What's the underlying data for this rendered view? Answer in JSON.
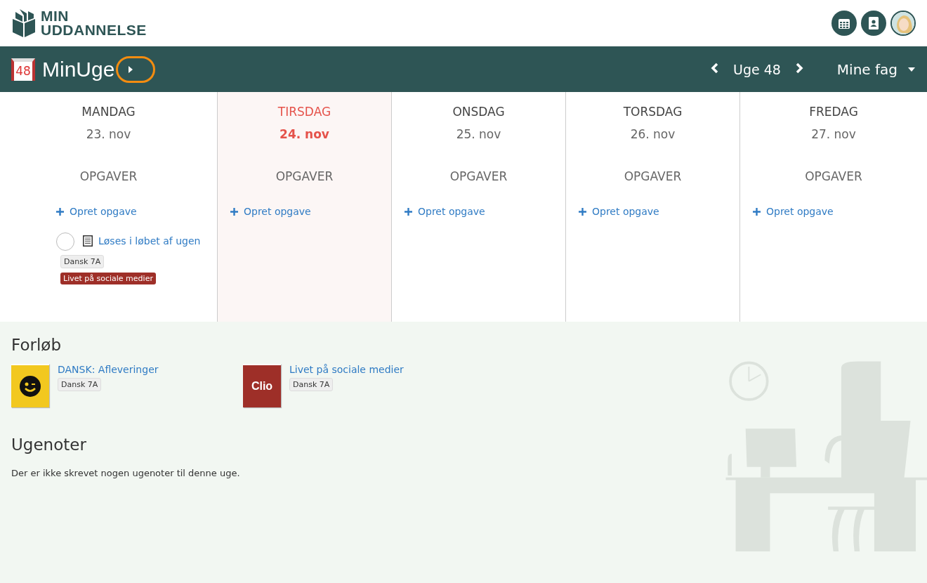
{
  "logo": {
    "line1": "MIN",
    "line2": "UDDANNELSE"
  },
  "header": {
    "calendar_badge": "48",
    "title": "MinUge",
    "week_label": "Uge 48",
    "subjects_menu": "Mine fag"
  },
  "days": [
    {
      "name": "MANDAG",
      "date": "23. nov",
      "selected": false,
      "section": "OPGAVER",
      "create_label": "Opret opgave",
      "tasks": [
        {
          "title": "Løses i løbet af ugen",
          "checked": false,
          "class_tag": "Dansk 7A",
          "course_tag": "Livet på sociale medier",
          "color": "#9e2f28"
        }
      ]
    },
    {
      "name": "TIRSDAG",
      "date": "24. nov",
      "selected": true,
      "section": "OPGAVER",
      "create_label": "Opret opgave"
    },
    {
      "name": "ONSDAG",
      "date": "25. nov",
      "selected": false,
      "section": "OPGAVER",
      "create_label": "Opret opgave"
    },
    {
      "name": "TORSDAG",
      "date": "26. nov",
      "selected": false,
      "section": "OPGAVER",
      "create_label": "Opret opgave"
    },
    {
      "name": "FREDAG",
      "date": "27. nov",
      "selected": false,
      "section": "OPGAVER",
      "create_label": "Opret opgave"
    }
  ],
  "courses": {
    "heading": "Forløb",
    "items": [
      {
        "kind": "smiley",
        "title": "DANSK: Afleveringer",
        "tag": "Dansk 7A",
        "color": "#f2c81f"
      },
      {
        "kind": "clio",
        "title": "Livet på sociale medier",
        "tag": "Dansk 7A",
        "color": "#9e2f28",
        "cover_text": "Clio"
      }
    ]
  },
  "notes": {
    "heading": "Ugenoter",
    "text": "Der er ikke skrevet nogen ugenoter til denne uge."
  }
}
